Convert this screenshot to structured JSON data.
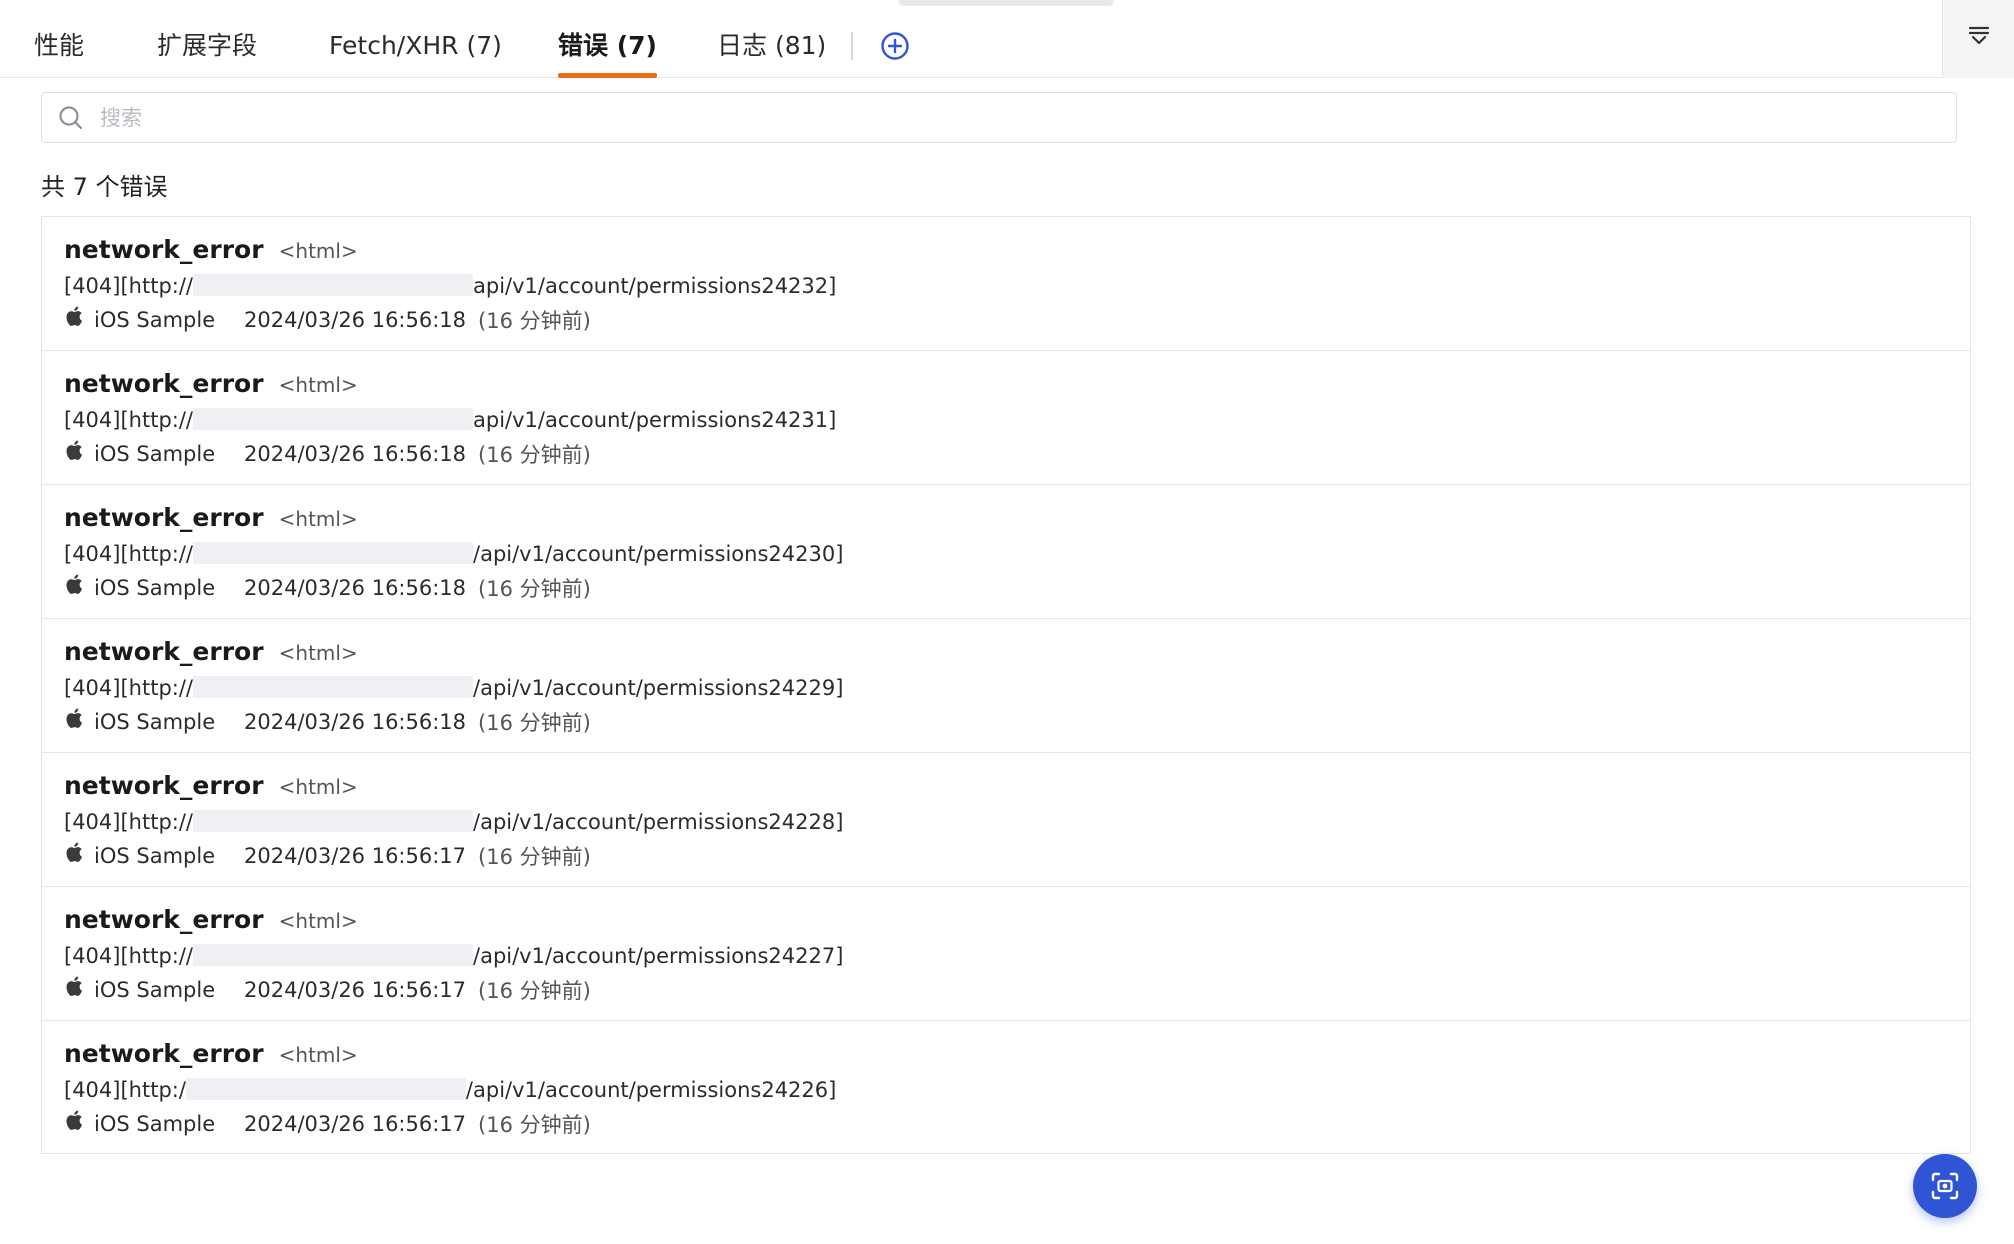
{
  "tabs": [
    {
      "label": "性能",
      "active": false
    },
    {
      "label": "扩展字段",
      "active": false
    },
    {
      "label": "Fetch/XHR (7)",
      "active": false
    },
    {
      "label": "错误 (7)",
      "active": true
    },
    {
      "label": "日志 (81)",
      "active": false
    }
  ],
  "search": {
    "placeholder": "搜索",
    "value": ""
  },
  "count_text": "共 7 个错误",
  "errors": [
    {
      "name": "network_error",
      "tag": "<html>",
      "msg_prefix": "[404][http://",
      "msg_suffix": "api/v1/account/permissions24232]",
      "app": "iOS Sample",
      "time": "2024/03/26 16:56:18",
      "ago": "(16 分钟前)"
    },
    {
      "name": "network_error",
      "tag": "<html>",
      "msg_prefix": "[404][http://",
      "msg_suffix": "api/v1/account/permissions24231]",
      "app": "iOS Sample",
      "time": "2024/03/26 16:56:18",
      "ago": "(16 分钟前)"
    },
    {
      "name": "network_error",
      "tag": "<html>",
      "msg_prefix": "[404][http://",
      "msg_suffix": "/api/v1/account/permissions24230]",
      "app": "iOS Sample",
      "time": "2024/03/26 16:56:18",
      "ago": "(16 分钟前)"
    },
    {
      "name": "network_error",
      "tag": "<html>",
      "msg_prefix": "[404][http://",
      "msg_suffix": "/api/v1/account/permissions24229]",
      "app": "iOS Sample",
      "time": "2024/03/26 16:56:18",
      "ago": "(16 分钟前)"
    },
    {
      "name": "network_error",
      "tag": "<html>",
      "msg_prefix": "[404][http://",
      "msg_suffix": "/api/v1/account/permissions24228]",
      "app": "iOS Sample",
      "time": "2024/03/26 16:56:17",
      "ago": "(16 分钟前)"
    },
    {
      "name": "network_error",
      "tag": "<html>",
      "msg_prefix": "[404][http://",
      "msg_suffix": "/api/v1/account/permissions24227]",
      "app": "iOS Sample",
      "time": "2024/03/26 16:56:17",
      "ago": "(16 分钟前)"
    },
    {
      "name": "network_error",
      "tag": "<html>",
      "msg_prefix": "[404][http:/",
      "msg_suffix": "/api/v1/account/permissions24226]",
      "app": "iOS Sample",
      "time": "2024/03/26 16:56:17",
      "ago": "(16 分钟前)"
    }
  ],
  "icons": {
    "add_tab": "plus-circle-icon",
    "side": "collapse-icon",
    "search": "search-icon",
    "platform": "apple-icon",
    "fab": "screenshot-scan-icon"
  },
  "colors": {
    "accent": "#f26a1b",
    "primary": "#2f55d4"
  }
}
